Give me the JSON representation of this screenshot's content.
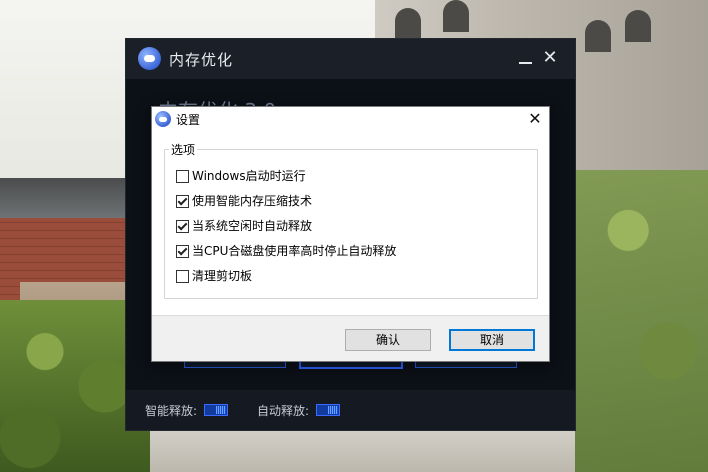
{
  "app": {
    "title": "内存优化",
    "heading": "内存优化 3.0",
    "minimize_icon": "minimize-icon",
    "close_icon": "close-icon",
    "footer": {
      "smart_release_label": "智能释放:",
      "auto_release_label": "自动释放:"
    }
  },
  "dialog": {
    "title": "设置",
    "close_glyph": "✕",
    "group_title": "选项",
    "options": [
      {
        "label": "Windows启动时运行",
        "checked": false
      },
      {
        "label": "使用智能内存压缩技术",
        "checked": true
      },
      {
        "label": "当系统空闲时自动释放",
        "checked": true
      },
      {
        "label": "当CPU合磁盘使用率高时停止自动释放",
        "checked": true
      },
      {
        "label": "清理剪切板",
        "checked": false
      }
    ],
    "ok_label": "确认",
    "cancel_label": "取消"
  },
  "colors": {
    "accent": "#0078d7",
    "app_background": "#0c1017",
    "toggle_on": "#2f63ff"
  }
}
